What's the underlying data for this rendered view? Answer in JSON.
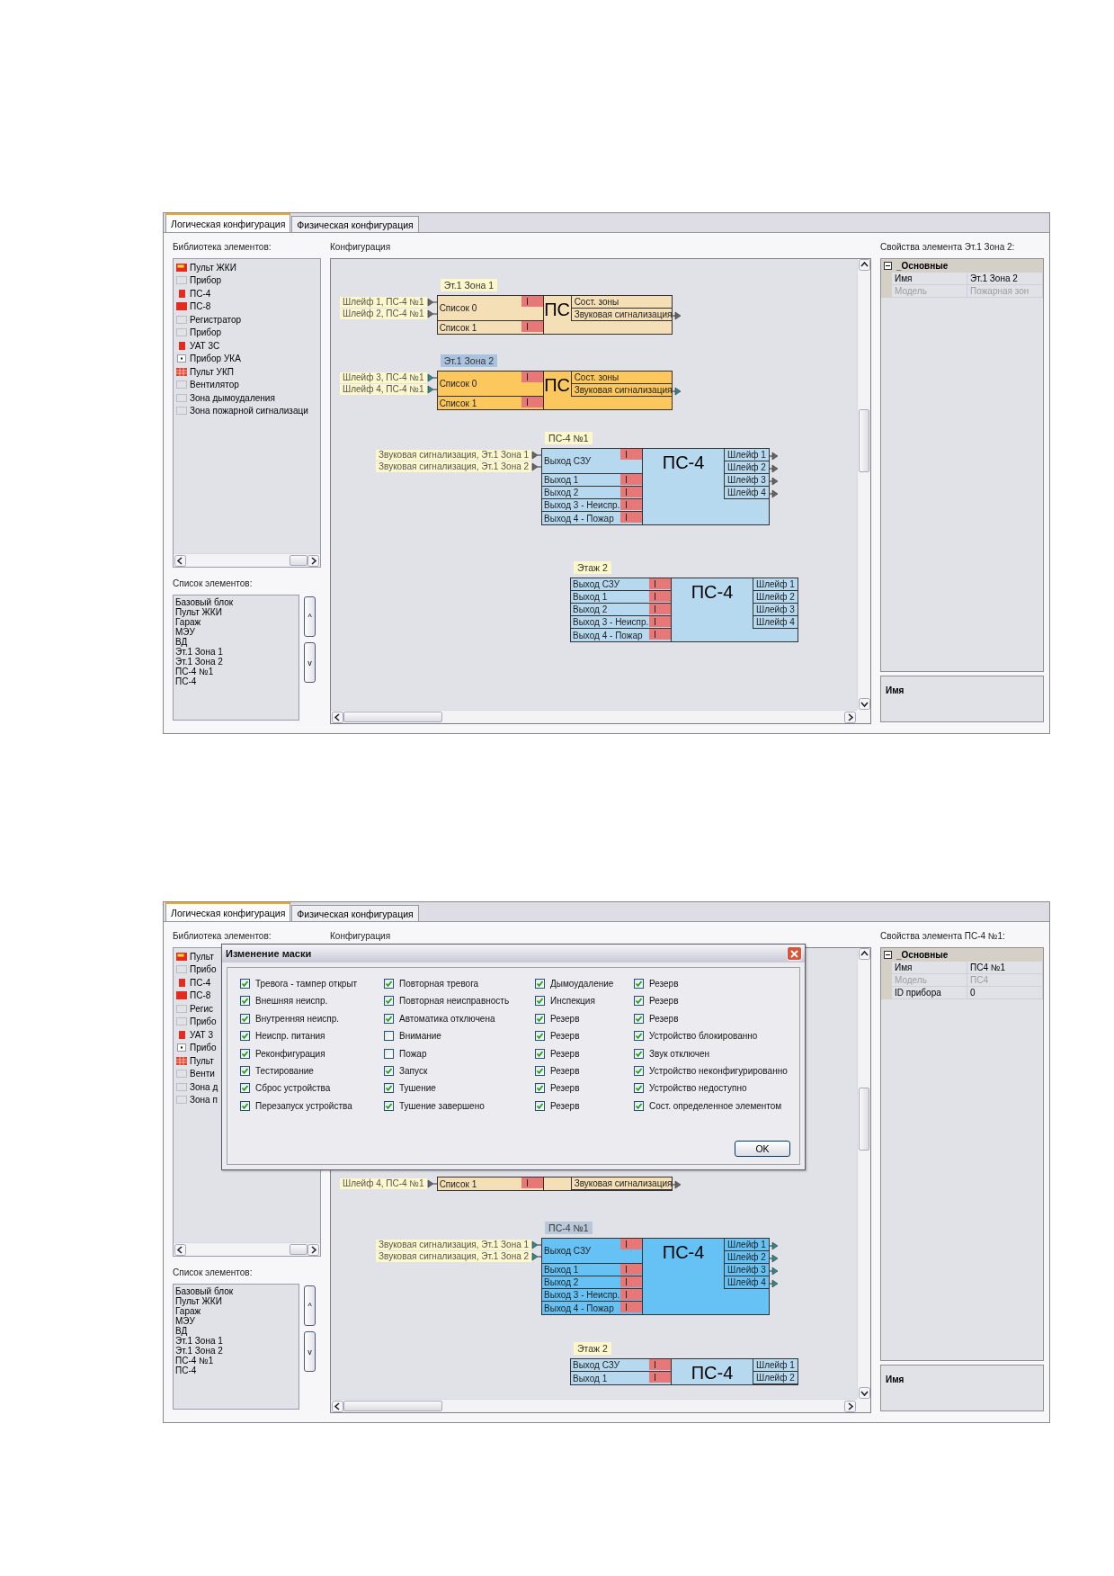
{
  "screens": [
    {
      "tabs": [
        {
          "label": "Логическая конфигурация",
          "selected": true
        },
        {
          "label": "Физическая конфигурация",
          "selected": false
        }
      ],
      "library": {
        "title": "Библиотека элементов:",
        "items": [
          {
            "label": "Пульт ЖКИ",
            "kind": "lcd"
          },
          {
            "label": "Прибор",
            "kind": "empty"
          },
          {
            "label": "ПС-4",
            "kind": "red"
          },
          {
            "label": "ПС-8",
            "kind": "wide"
          },
          {
            "label": "Регистратор",
            "kind": "empty"
          },
          {
            "label": "Прибор",
            "kind": "empty"
          },
          {
            "label": "УАТ 3С",
            "kind": "red"
          },
          {
            "label": "Прибор УКА",
            "kind": "dot"
          },
          {
            "label": "Пульт УКП",
            "kind": "grid"
          },
          {
            "label": "Вентилятор",
            "kind": "empty"
          },
          {
            "label": "Зона дымоудаления",
            "kind": "empty"
          },
          {
            "label": "Зона пожарной сигнализаци",
            "kind": "empty"
          }
        ]
      },
      "element_list": {
        "title": "Список элементов:",
        "items": [
          "Базовый блок",
          "Пульт ЖКИ",
          "Гараж",
          "МЭУ",
          "ВД",
          "Эт.1 Зона 1",
          "Эт.1 Зона 2",
          "ПС-4 №1",
          "ПС-4"
        ],
        "up": "^",
        "down": "v"
      },
      "canvas": {
        "title": "Конфигурация",
        "blocks": [
          {
            "kind": "zone",
            "title": "Эт.1 Зона 1",
            "selected": false,
            "inputs": [
              "Шлейф 1, ПС-4 №1",
              "Шлейф 2, ПС-4 №1"
            ],
            "label": "ПС",
            "lists": [
              "Список 0",
              "Список 1"
            ],
            "outputs": [
              {
                "label": "Сост. зоны",
                "connected": false
              },
              {
                "label": "Звуковая сигнализация",
                "connected": true
              }
            ]
          },
          {
            "kind": "zone",
            "title": "Эт.1 Зона 2",
            "selected": true,
            "inputs": [
              "Шлейф 3, ПС-4 №1",
              "Шлейф 4, ПС-4 №1"
            ],
            "label": "ПС",
            "lists": [
              "Список 0",
              "Список 1"
            ],
            "outputs": [
              {
                "label": "Сост. зоны",
                "connected": false
              },
              {
                "label": "Звуковая сигнализация",
                "connected": true
              }
            ]
          },
          {
            "kind": "device",
            "title": "ПС-4 №1",
            "selected": false,
            "inputs": [
              "Звуковая сигнализация, Эт.1 Зона 1",
              "Звуковая сигнализация, Эт.1 Зона 2"
            ],
            "label": "ПС-4",
            "lists": [
              "Выход СЗУ",
              "Выход 1",
              "Выход 2",
              "Выход 3 - Неиспр.",
              "Выход 4 - Пожар"
            ],
            "outputs": [
              {
                "label": "Шлейф 1",
                "connected": true
              },
              {
                "label": "Шлейф 2",
                "connected": true
              },
              {
                "label": "Шлейф 3",
                "connected": true
              },
              {
                "label": "Шлейф 4",
                "connected": true
              }
            ]
          },
          {
            "kind": "device",
            "title": "Этаж 2",
            "selected": false,
            "label": "ПС-4",
            "lists": [
              "Выход СЗУ",
              "Выход 1",
              "Выход 2",
              "Выход 3 - Неиспр.",
              "Выход 4 - Пожар"
            ],
            "outputs": [
              {
                "label": "Шлейф 1",
                "connected": false
              },
              {
                "label": "Шлейф 2",
                "connected": false
              },
              {
                "label": "Шлейф 3",
                "connected": false
              },
              {
                "label": "Шлейф 4",
                "connected": false
              }
            ]
          }
        ]
      },
      "properties": {
        "title": "Свойства элемента Эт.1 Зона 2:",
        "group": "_Основные",
        "rows": [
          {
            "name": "Имя",
            "value": "Эт.1 Зона 2",
            "disabled": false
          },
          {
            "name": "Модель",
            "value": "Пожарная зон",
            "disabled": true
          }
        ],
        "description": "Имя"
      }
    },
    {
      "tabs": [
        {
          "label": "Логическая конфигурация",
          "selected": true
        },
        {
          "label": "Физическая конфигурация",
          "selected": false
        }
      ],
      "library": {
        "title": "Библиотека элементов:",
        "items": [
          {
            "label": "Пульт",
            "kind": "lcd"
          },
          {
            "label": "Прибо",
            "kind": "empty"
          },
          {
            "label": "ПС-4",
            "kind": "red"
          },
          {
            "label": "ПС-8",
            "kind": "wide"
          },
          {
            "label": "Регис",
            "kind": "empty"
          },
          {
            "label": "Прибо",
            "kind": "empty"
          },
          {
            "label": "УАТ 3",
            "kind": "red"
          },
          {
            "label": "Прибо",
            "kind": "dot"
          },
          {
            "label": "Пульт",
            "kind": "grid"
          },
          {
            "label": "Венти",
            "kind": "empty"
          },
          {
            "label": "Зона д",
            "kind": "empty"
          },
          {
            "label": "Зона п",
            "kind": "empty"
          }
        ]
      },
      "element_list": {
        "title": "Список элементов:",
        "items": [
          "Базовый блок",
          "Пульт ЖКИ",
          "Гараж",
          "МЭУ",
          "ВД",
          "Эт.1 Зона 1",
          "Эт.1 Зона 2",
          "ПС-4 №1",
          "ПС-4"
        ],
        "up": "^",
        "down": "v"
      },
      "canvas": {
        "title": "Конфигурация",
        "blocks": [
          {
            "kind": "zone",
            "selected": false,
            "inputs": [
              "Шлейф 4, ПС-4 №1"
            ],
            "lists": [
              "Список 1"
            ],
            "outputs": [
              {
                "label": "Звуковая сигнализация",
                "connected": true
              }
            ]
          },
          {
            "kind": "device",
            "title": "ПС-4 №1",
            "selected": true,
            "inputs": [
              "Звуковая сигнализация, Эт.1 Зона 1",
              "Звуковая сигнализация, Эт.1 Зона 2"
            ],
            "label": "ПС-4",
            "lists": [
              "Выход СЗУ",
              "Выход 1",
              "Выход 2",
              "Выход 3 - Неиспр.",
              "Выход 4 - Пожар"
            ],
            "outputs": [
              {
                "label": "Шлейф 1",
                "connected": true
              },
              {
                "label": "Шлейф 2",
                "connected": true
              },
              {
                "label": "Шлейф 3",
                "connected": true
              },
              {
                "label": "Шлейф 4",
                "connected": true
              }
            ]
          },
          {
            "kind": "device",
            "title": "Этаж 2",
            "selected": false,
            "label": "ПС-4",
            "lists": [
              "Выход СЗУ",
              "Выход 1"
            ],
            "outputs": [
              {
                "label": "Шлейф 1",
                "connected": false
              },
              {
                "label": "Шлейф 2",
                "connected": false
              }
            ]
          }
        ]
      },
      "properties": {
        "title": "Свойства элемента ПС-4 №1:",
        "group": "_Основные",
        "rows": [
          {
            "name": "Имя",
            "value": "ПС4 №1",
            "disabled": false
          },
          {
            "name": "Модель",
            "value": "ПС4",
            "disabled": true
          },
          {
            "name": "ID прибора",
            "value": "0",
            "disabled": false
          }
        ],
        "description": "Имя"
      },
      "dialog": {
        "title": "Изменение маски",
        "ok": "OK",
        "columns": [
          {
            "items": [
              {
                "label": "Тревога - тампер открыт",
                "checked": true
              },
              {
                "label": "Внешняя неиспр.",
                "checked": true
              },
              {
                "label": "Внутренняя неиспр.",
                "checked": true
              },
              {
                "label": "Неиспр. питания",
                "checked": true
              },
              {
                "label": "Реконфигурация",
                "checked": true
              },
              {
                "label": "Тестирование",
                "checked": true
              },
              {
                "label": "Сброс устройства",
                "checked": true
              },
              {
                "label": "Перезапуск устройства",
                "checked": true
              }
            ]
          },
          {
            "items": [
              {
                "label": "Повторная тревога",
                "checked": true
              },
              {
                "label": "Повторная неисправность",
                "checked": true
              },
              {
                "label": "Автоматика отключена",
                "checked": true
              },
              {
                "label": "Внимание",
                "checked": false
              },
              {
                "label": "Пожар",
                "checked": false
              },
              {
                "label": "Запуск",
                "checked": true
              },
              {
                "label": "Тушение",
                "checked": true
              },
              {
                "label": "Тушение завершено",
                "checked": true
              }
            ]
          },
          {
            "items": [
              {
                "label": "Дымоудаление",
                "checked": true
              },
              {
                "label": "Инспекция",
                "checked": true
              },
              {
                "label": "Резерв",
                "checked": true
              },
              {
                "label": "Резерв",
                "checked": true
              },
              {
                "label": "Резерв",
                "checked": true
              },
              {
                "label": "Резерв",
                "checked": true
              },
              {
                "label": "Резерв",
                "checked": true
              },
              {
                "label": "Резерв",
                "checked": true
              }
            ]
          },
          {
            "items": [
              {
                "label": "Резерв",
                "checked": true
              },
              {
                "label": "Резерв",
                "checked": true
              },
              {
                "label": "Резерв",
                "checked": true
              },
              {
                "label": "Устройство блокированно",
                "checked": true
              },
              {
                "label": "Звук отключен",
                "checked": true
              },
              {
                "label": "Устройство неконфигурированно",
                "checked": true
              },
              {
                "label": "Устройство недоступно",
                "checked": true
              },
              {
                "label": "Сост. определенное элементом",
                "checked": true
              }
            ]
          }
        ]
      }
    }
  ]
}
